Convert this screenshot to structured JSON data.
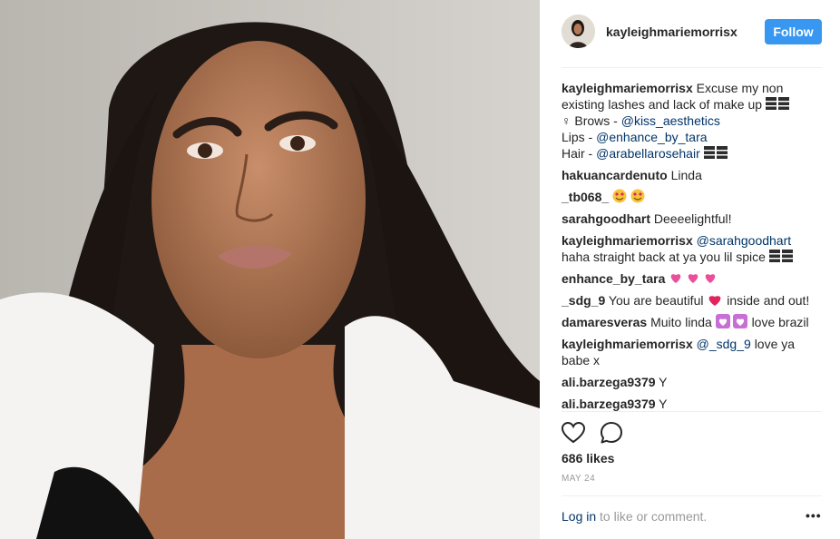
{
  "header": {
    "username": "kayleighmariemorrisx",
    "follow_label": "Follow"
  },
  "caption": {
    "user": "kayleighmariemorrisx",
    "line1": "Excuse my non existing lashes and lack of make up",
    "brows_prefix": "♀   Brows - ",
    "brows_mention": "@kiss_aesthetics",
    "lips_prefix": "Lips - ",
    "lips_mention": "@enhance_by_tara",
    "hair_prefix": "Hair - ",
    "hair_mention": "@arabellarosehair"
  },
  "comments": [
    {
      "user": "hakuancardenuto",
      "text": "Linda"
    },
    {
      "user": "_tb068_",
      "text": ""
    },
    {
      "user": "sarahgoodhart",
      "text": "Deeeelightful!"
    },
    {
      "user": "kayleighmariemorrisx",
      "mention": "@sarahgoodhart",
      "text": "haha straight back at ya you lil spice"
    },
    {
      "user": "enhance_by_tara",
      "text": ""
    },
    {
      "user": "_sdg_9",
      "text": "You are beautiful",
      "text2": "inside and out!"
    },
    {
      "user": "damaresveras",
      "text": "Muito linda",
      "text2": "love brazil"
    },
    {
      "user": "kayleighmariemorrisx",
      "mention": "@_sdg_9",
      "text": "love ya babe x"
    },
    {
      "user": "ali.barzega9379",
      "text": "Y"
    },
    {
      "user": "ali.barzega9379",
      "text": "Y"
    }
  ],
  "stats": {
    "likes": "686 likes",
    "date": "MAY 24"
  },
  "footer": {
    "login": "Log in",
    "rest": " to like or comment.",
    "more": "•••"
  },
  "colors": {
    "follow_blue": "#3897f0",
    "mention_blue": "#003569",
    "muted_gray": "#999999"
  },
  "icons": [
    "heart-icon",
    "comment-icon",
    "more-options-icon"
  ]
}
